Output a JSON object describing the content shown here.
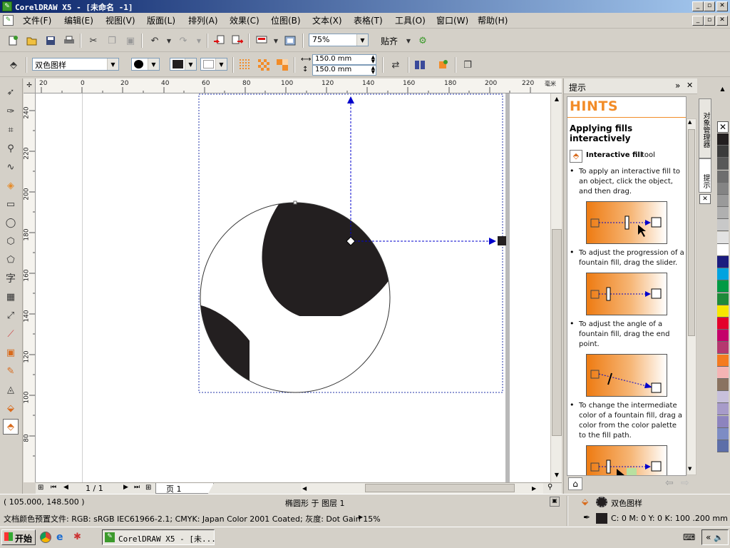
{
  "title_bar": {
    "title": "CorelDRAW X5 - [未命名 -1]"
  },
  "menu": {
    "items": [
      "文件(F)",
      "编辑(E)",
      "视图(V)",
      "版面(L)",
      "排列(A)",
      "效果(C)",
      "位图(B)",
      "文本(X)",
      "表格(T)",
      "工具(O)",
      "窗口(W)",
      "帮助(H)"
    ]
  },
  "toolbar": {
    "zoom": "75%",
    "snap_label": "贴齐"
  },
  "propbar": {
    "fill_type": "双色图样",
    "width": "150.0 mm",
    "height": "150.0 mm"
  },
  "ruler": {
    "top_ticks": [
      "20",
      "0",
      "20",
      "40",
      "60",
      "80",
      "100",
      "120",
      "140",
      "160",
      "180",
      "200",
      "220"
    ],
    "unit": "毫米",
    "left_ticks": [
      "240",
      "220",
      "200",
      "180",
      "160",
      "140",
      "120",
      "100",
      "80"
    ]
  },
  "tabs": {
    "page_count": "1 / 1",
    "page_tab": "页 1"
  },
  "docker": {
    "title": "提示",
    "heading": "HINTS",
    "subtitle": "Applying fills interactively",
    "tool_bold": "Interactive fill",
    "tool_suffix": "tool",
    "bullets": [
      "To apply an interactive fill to an object, click the object, and then drag.",
      "To adjust the progression of a fountain fill, drag the slider.",
      "To adjust the angle of a fountain fill, drag the end point.",
      "To change the intermediate color of a fountain fill, drag a color from the color palette to the fill path."
    ],
    "side_tabs": [
      "对象管理器",
      "提示"
    ]
  },
  "status": {
    "coords": "( 105.000, 148.500 )",
    "object_info": "椭圆形 于 图层 1",
    "fill_name": "双色图样",
    "profile": "文档颜色预置文件: RGB: sRGB IEC61966-2.1; CMYK: Japan Color 2001 Coated; 灰度: Dot Gain 15%",
    "outline": "C: 0 M: 0 Y: 0 K: 100  .200 mm"
  },
  "taskbar": {
    "start": "开始",
    "task": "CorelDRAW X5 - [未..."
  },
  "palette_colors": [
    "#231f20",
    "#3c3c3c",
    "#585858",
    "#6e6e6e",
    "#848484",
    "#9a9a9a",
    "#b0b0b0",
    "#c8c8c8",
    "#e2e2e2",
    "#ffffff",
    "#1b1c7e",
    "#00a3e0",
    "#009a44",
    "#1f8a3a",
    "#f7e600",
    "#e4002b",
    "#c4006a",
    "#b5386f",
    "#f47b20",
    "#f4b4b4",
    "#8a7360",
    "#c7c0dc",
    "#a79bc9",
    "#8d84be",
    "#7d8cc4",
    "#5d6ea8"
  ],
  "colors": {
    "accent_orange": "#f28c28",
    "selection_blue": "#0000cc"
  }
}
